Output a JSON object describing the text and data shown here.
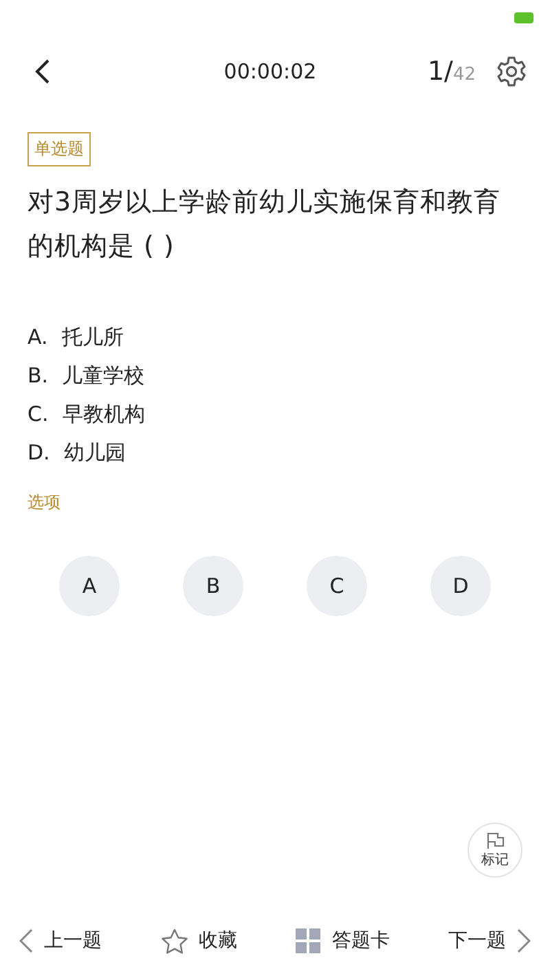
{
  "header": {
    "timer": "00:00:02",
    "progress_current": "1/",
    "progress_total": "42"
  },
  "question": {
    "type_tag": "单选题",
    "text": "对3周岁以上学龄前幼儿实施保育和教育的机构是 ( )",
    "options": [
      {
        "letter": "A.",
        "text": "托儿所"
      },
      {
        "letter": "B.",
        "text": "儿童学校"
      },
      {
        "letter": "C.",
        "text": "早教机构"
      },
      {
        "letter": "D.",
        "text": "幼儿园"
      }
    ]
  },
  "answer": {
    "label": "选项",
    "choices": [
      {
        "letter": "A",
        "selected": false
      },
      {
        "letter": "B",
        "selected": false
      },
      {
        "letter": "C",
        "selected": false
      },
      {
        "letter": "D",
        "selected": false
      }
    ]
  },
  "mark_button": "标记",
  "bottom_bar": {
    "prev": "上一题",
    "favorite": "收藏",
    "answer_card": "答题卡",
    "next": "下一题"
  }
}
